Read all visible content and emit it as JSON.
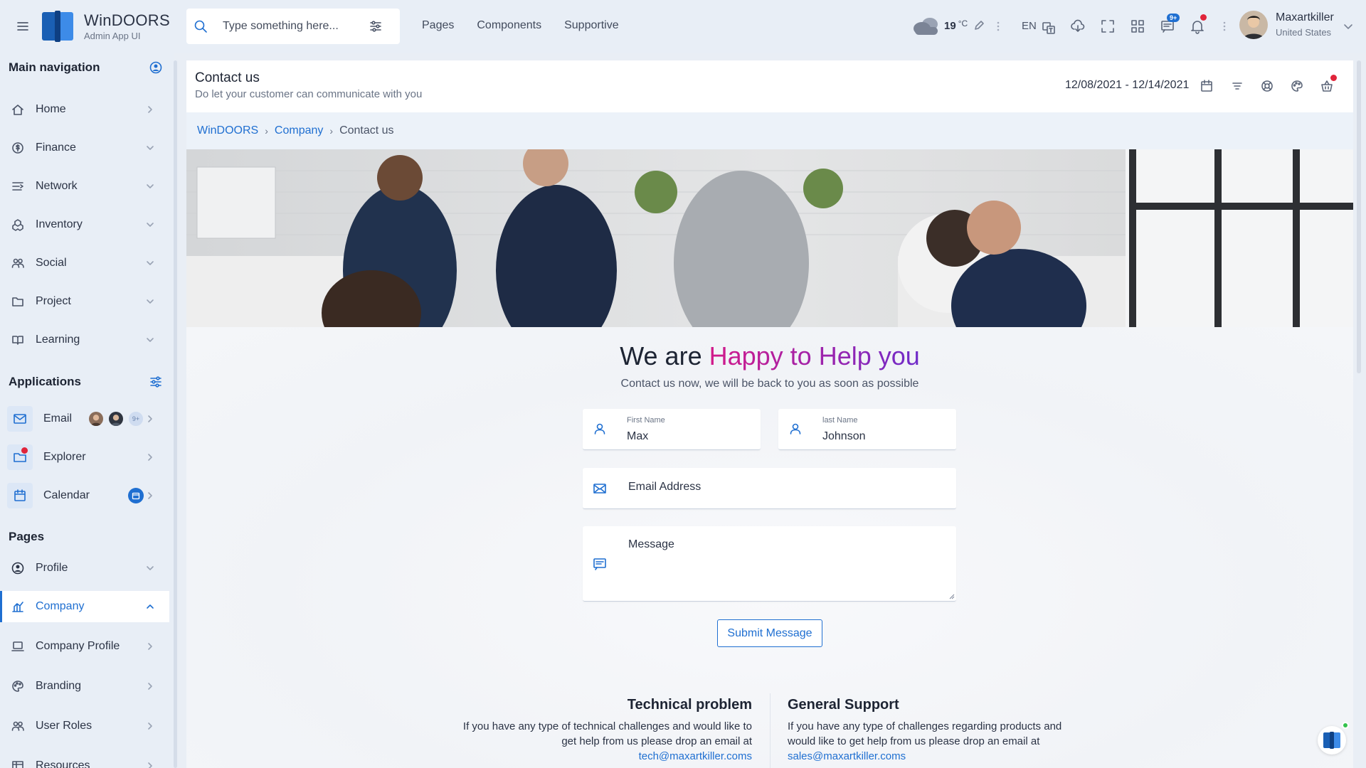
{
  "app": {
    "title": "WinDOORS",
    "subtitle": "Admin App UI"
  },
  "search": {
    "placeholder": "Type something here..."
  },
  "topnav": [
    "Pages",
    "Components",
    "Supportive"
  ],
  "weather": {
    "temp": "19",
    "unit": "°C"
  },
  "lang": "EN",
  "badges": {
    "messages": "9+"
  },
  "user": {
    "name": "Maxartkiller",
    "country": "United States"
  },
  "sidebar": {
    "main_title": "Main navigation",
    "main_items": [
      {
        "label": "Home",
        "icon": "home-icon",
        "chevron": "right"
      },
      {
        "label": "Finance",
        "icon": "dollar-icon",
        "chevron": "down"
      },
      {
        "label": "Network",
        "icon": "network-icon",
        "chevron": "down"
      },
      {
        "label": "Inventory",
        "icon": "boxes-icon",
        "chevron": "down"
      },
      {
        "label": "Social",
        "icon": "people-icon",
        "chevron": "down"
      },
      {
        "label": "Project",
        "icon": "folder-icon",
        "chevron": "down"
      },
      {
        "label": "Learning",
        "icon": "book-icon",
        "chevron": "down"
      }
    ],
    "apps_title": "Applications",
    "apps": [
      {
        "label": "Email",
        "icon": "envelope-icon",
        "extra": "9+"
      },
      {
        "label": "Explorer",
        "icon": "folder-icon"
      },
      {
        "label": "Calendar",
        "icon": "calendar-icon"
      }
    ],
    "pages_title": "Pages",
    "pages": [
      {
        "label": "Profile",
        "icon": "user-circle-icon",
        "chevron": "down"
      },
      {
        "label": "Company",
        "icon": "chart-icon",
        "chevron": "up",
        "active": true
      },
      {
        "label": "Company Profile",
        "icon": "laptop-icon",
        "chevron": "right"
      },
      {
        "label": "Branding",
        "icon": "palette-icon",
        "chevron": "right"
      },
      {
        "label": "User Roles",
        "icon": "people-icon",
        "chevron": "right"
      },
      {
        "label": "Resources",
        "icon": "table-icon",
        "chevron": "right"
      }
    ]
  },
  "page": {
    "title": "Contact us",
    "subtitle": "Do let your customer can communicate with you",
    "daterange": "12/08/2021 - 12/14/2021",
    "breadcrumb": [
      "WinDOORS",
      "Company",
      "Contact us"
    ]
  },
  "contact": {
    "headline_plain": "We are",
    "headline_accent": "Happy to Help you",
    "subline": "Contact us now, we will be back to you as soon as possible",
    "first_name_label": "First Name",
    "first_name_value": "Max",
    "last_name_label": "last Name",
    "last_name_value": "Johnson",
    "email_placeholder": "Email Address",
    "message_placeholder": "Message",
    "submit_label": "Submit Message"
  },
  "info": {
    "tech_title": "Technical problem",
    "tech_text": "If you have any type of technical challenges and would like to get help from us please drop an email at",
    "tech_email": "tech@maxartkiller.coms",
    "general_title": "General Support",
    "general_text": "If you have any type of challenges regarding products and would like to get help from us please drop an email at",
    "general_email": "sales@maxartkiller.coms"
  },
  "colors": {
    "accent": "#1f6fd1",
    "headline_gradient_start": "#d21a8a",
    "headline_gradient_end": "#6f2bc9"
  }
}
